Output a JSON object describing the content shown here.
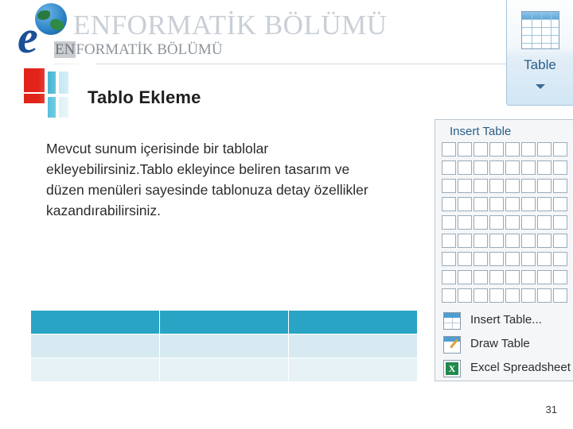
{
  "header": {
    "watermark_title": "ENFORMATİK BÖLÜMÜ",
    "department_prefix": "EN",
    "department_rest": "FORMATİK BÖLÜMÜ",
    "logo_letter": "e"
  },
  "slide": {
    "title": "Tablo Ekleme",
    "body": "Mevcut sunum içerisinde bir tablolar ekleyebilirsiniz.Tablo ekleyince beliren tasarım ve düzen menüleri sayesinde tablonuza detay özellikler kazandırabilirsiniz.",
    "number": "31"
  },
  "table": {
    "columns": 3,
    "rows": 3,
    "header_color": "#2aa4c4",
    "row1_color": "#d7eaf1",
    "row2_color": "#e6f2f6",
    "cells": [
      [
        "",
        "",
        ""
      ],
      [
        "",
        "",
        ""
      ],
      [
        "",
        "",
        ""
      ]
    ]
  },
  "ribbon_button": {
    "label": "Table",
    "icon": "table-grid-icon",
    "caret": "chevron-down-icon"
  },
  "insert_panel": {
    "title": "Insert Table",
    "grid": {
      "columns": 8,
      "rows": 9
    },
    "menu_items": [
      {
        "label": "Insert Table...",
        "icon": "insert-table-icon"
      },
      {
        "label": "Draw Table",
        "icon": "draw-table-icon"
      },
      {
        "label": "Excel Spreadsheet",
        "icon": "excel-spreadsheet-icon"
      }
    ]
  },
  "colors": {
    "accent_teal": "#2aa4c4",
    "accent_blue": "#1b4f96",
    "accent_red": "#e2231a",
    "watermark_gray": "#c9cfd6"
  }
}
